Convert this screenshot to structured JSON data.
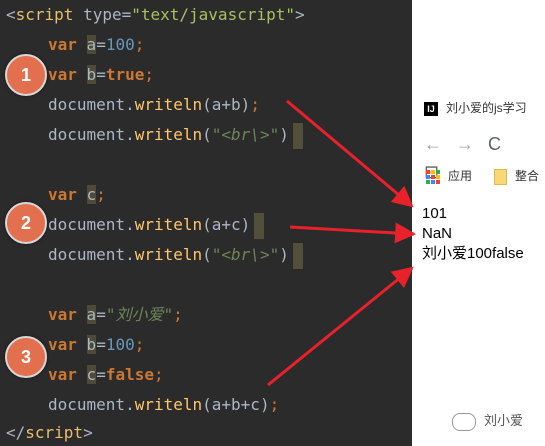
{
  "editor": {
    "lines": {
      "script_open": {
        "lt": "<",
        "tag": "script",
        "attr": " type=",
        "val": "\"text/javascript\"",
        "gt": ">"
      },
      "l1": {
        "kw": "var",
        "sp": " ",
        "name": "a",
        "eq": "=",
        "num": "100",
        "semi": ";"
      },
      "l2": {
        "kw": "var",
        "sp": " ",
        "name": "b",
        "eq": "=",
        "val": "true",
        "semi": ";"
      },
      "l3": {
        "obj": "document.",
        "fn": "writeln",
        "args": "(a+b)",
        "semi": ";"
      },
      "l4": {
        "obj": "document.",
        "fn": "writeln",
        "open": "(",
        "str": "\"<br\\>\"",
        "close": ")"
      },
      "l5": {
        "kw": "var",
        "sp": " ",
        "name": "c",
        "semi": ";"
      },
      "l6": {
        "obj": "document.",
        "fn": "writeln",
        "args": "(a+c)"
      },
      "l7": {
        "obj": "document.",
        "fn": "writeln",
        "open": "(",
        "str": "\"<br\\>\"",
        "close": ")"
      },
      "l8": {
        "kw": "var",
        "sp": " ",
        "name": "a",
        "eq": "=",
        "str": "\"刘小爱\"",
        "semi": ";"
      },
      "l9": {
        "kw": "var",
        "sp": " ",
        "name": "b",
        "eq": "=",
        "num": "100",
        "semi": ";"
      },
      "l10": {
        "kw": "var",
        "sp": " ",
        "name": "c",
        "eq": "=",
        "val": "false",
        "semi": ";"
      },
      "l11": {
        "obj": "document.",
        "fn": "writeln",
        "args": "(a+b+c)",
        "semi": ";"
      },
      "script_close": {
        "lt": "</",
        "tag": "script",
        "gt": ">"
      }
    },
    "markers": [
      "1",
      "2",
      "3"
    ]
  },
  "browser": {
    "tab_favicon": "IJ",
    "tab_title": "刘小爱的js学习",
    "nav_icons": [
      "back-icon",
      "forward-icon",
      "reload-icon",
      "bookmark-icon"
    ],
    "nav_glyphs": {
      "back": "←",
      "forward": "→",
      "reload": "C",
      "bookmark": "⊡"
    },
    "bookmarks": {
      "apps_label": "应用",
      "folder_label": "整合"
    },
    "output": [
      "101",
      "NaN",
      "刘小爱100false"
    ]
  },
  "watermark": {
    "text": "刘小爱"
  },
  "colors": {
    "editor_bg": "#2b2b2b",
    "keyword": "#cc7832",
    "number": "#6897bb",
    "string": "#6a8759",
    "function": "#ffc66d",
    "marker": "#e26f4e",
    "arrow": "#e8212b"
  }
}
